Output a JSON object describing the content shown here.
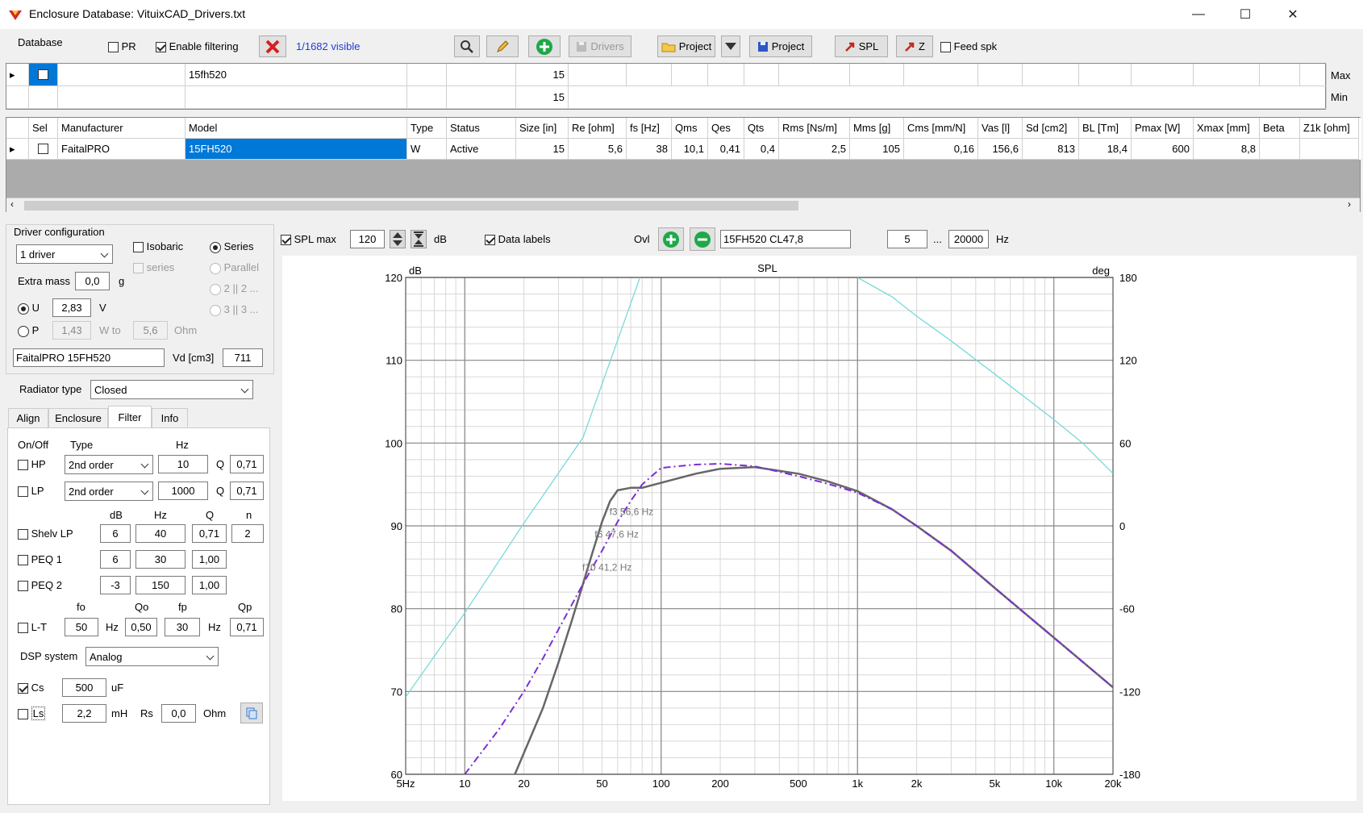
{
  "window": {
    "title": "Enclosure  Database: VituixCAD_Drivers.txt",
    "minimize": "—",
    "maximize": "☐",
    "close": "✕"
  },
  "toolbar": {
    "database_label": "Database",
    "pr_label": "PR",
    "pr_checked": false,
    "filter_label": "Enable filtering",
    "filter_checked": true,
    "visible_count": "1/1682 visible",
    "drivers_label": "Drivers",
    "project_open_label": "Project",
    "project_save_label": "Project",
    "spl_label": "SPL",
    "z_label": "Z",
    "feed_label": "Feed spk",
    "feed_checked": false
  },
  "filter_rows": {
    "max_model": "15fh520",
    "max_size": "15",
    "min_size": "15",
    "max_label": "Max",
    "min_label": "Min"
  },
  "table": {
    "columns": [
      "Sel",
      "Manufacturer",
      "Model",
      "Type",
      "Status",
      "Size [in]",
      "Re [ohm]",
      "fs [Hz]",
      "Qms",
      "Qes",
      "Qts",
      "Rms [Ns/m]",
      "Mms [g]",
      "Cms [mm/N]",
      "Vas [l]",
      "Sd [cm2]",
      "BL [Tm]",
      "Pmax [W]",
      "Xmax [mm]",
      "Beta",
      "Z1k [ohm]"
    ],
    "rows": [
      [
        "",
        "FaitalPRO",
        "15FH520",
        "W",
        "Active",
        "15",
        "5,6",
        "38",
        "10,1",
        "0,41",
        "0,4",
        "2,5",
        "105",
        "0,16",
        "156,6",
        "813",
        "18,4",
        "600",
        "8,8",
        "",
        ""
      ]
    ]
  },
  "driver_config": {
    "group_label": "Driver configuration",
    "driver_count": "1 driver",
    "isobaric_label": "Isobaric",
    "series_label": "Series",
    "series_small_label": "series",
    "parallel_label": "Parallel",
    "p22_label": "2 || 2 ...",
    "p33_label": "3 || 3 ...",
    "extra_mass_label": "Extra mass",
    "extra_mass": "0,0",
    "g_unit": "g",
    "u_label": "U",
    "u_value": "2,83",
    "v_unit": "V",
    "p_label": "P",
    "p_value": "1,43",
    "w_to_label": "W to",
    "ohm_value": "5,6",
    "ohm_unit": "Ohm",
    "driver_name": "FaitalPRO 15FH520",
    "vd_label": "Vd [cm3]",
    "vd_value": "711"
  },
  "radiator": {
    "label": "Radiator type",
    "value": "Closed"
  },
  "tabs": [
    "Align",
    "Enclosure",
    "Filter",
    "Info"
  ],
  "filter": {
    "onoff_label": "On/Off",
    "type_label": "Type",
    "hz_label": "Hz",
    "q_label": "Q",
    "hp": {
      "label": "HP",
      "type": "2nd order",
      "hz": "10",
      "q": "0,71"
    },
    "lp": {
      "label": "LP",
      "type": "2nd order",
      "hz": "1000",
      "q": "0,71"
    },
    "col_db": "dB",
    "col_hz": "Hz",
    "col_q": "Q",
    "col_n": "n",
    "shelv": {
      "label": "Shelv LP",
      "db": "6",
      "hz": "40",
      "q": "0,71",
      "n": "2"
    },
    "peq1": {
      "label": "PEQ 1",
      "db": "6",
      "hz": "30",
      "q": "1,00"
    },
    "peq2": {
      "label": "PEQ 2",
      "db": "-3",
      "hz": "150",
      "q": "1,00"
    },
    "lt_fo": "fo",
    "lt_qo": "Qo",
    "lt_fp": "fp",
    "lt_qp": "Qp",
    "lt": {
      "label": "L-T",
      "fo": "50",
      "hz1": "Hz",
      "qo": "0,50",
      "fp": "30",
      "hz2": "Hz",
      "qp": "0,71"
    },
    "dsp_label": "DSP system",
    "dsp_value": "Analog",
    "cs": {
      "label": "Cs",
      "value": "500",
      "unit": "uF",
      "checked": true
    },
    "ls": {
      "label": "Ls",
      "value": "2,2",
      "unit": "mH",
      "rs_label": "Rs",
      "rs_value": "0,0",
      "rs_unit": "Ohm"
    }
  },
  "chart_toolbar": {
    "spl_max_label": "SPL max",
    "spl_max": "120",
    "db_unit": "dB",
    "data_labels": "Data labels",
    "ovl_label": "Ovl",
    "overlay_name": "15FH520 CL47,8",
    "f_min": "5",
    "dots": "...",
    "f_max": "20000",
    "hz_unit": "Hz"
  },
  "colors": {
    "selection": "#0078d7",
    "spl_gray": "#666666",
    "overlay": "#7b2fd6",
    "phase": "#7ad9d9",
    "link": "#1e3ed6"
  },
  "chart_data": {
    "type": "line",
    "title": "SPL",
    "ylabel_left": "dB",
    "ylabel_right": "deg",
    "xscale": "log",
    "xlim": [
      5,
      20000
    ],
    "ylim": [
      60,
      120
    ],
    "y2lim": [
      -180,
      180
    ],
    "xticks": [
      "5Hz",
      "10",
      "20",
      "50",
      "100",
      "200",
      "500",
      "1k",
      "2k",
      "5k",
      "10k",
      "20k"
    ],
    "xtick_values": [
      5,
      10,
      20,
      50,
      100,
      200,
      500,
      1000,
      2000,
      5000,
      10000,
      20000
    ],
    "yticks": [
      60,
      70,
      80,
      90,
      100,
      110,
      120
    ],
    "y2ticks": [
      -180,
      -120,
      -60,
      0,
      60,
      120,
      180
    ],
    "annotations": [
      {
        "text": "f3 56,6 Hz",
        "x": 56.6,
        "y": 91.7
      },
      {
        "text": "f6 47,6 Hz",
        "x": 47.6,
        "y": 89
      },
      {
        "text": "f10 41,2 Hz",
        "x": 41.2,
        "y": 85
      }
    ],
    "series": [
      {
        "role": "spl",
        "axis": "left",
        "x": [
          18,
          25,
          30,
          35,
          40,
          45,
          50,
          55,
          60,
          70,
          80,
          100,
          150,
          200,
          300,
          500,
          700,
          1000,
          1500,
          2000,
          3000,
          5000,
          10000,
          20000
        ],
        "y": [
          60,
          68,
          73.5,
          78.5,
          83,
          87,
          90.5,
          93,
          94.3,
          94.6,
          94.6,
          95.2,
          96.3,
          96.9,
          97.1,
          96.3,
          95.4,
          94.2,
          92.0,
          90.0,
          87.0,
          82.5,
          76.5,
          70.5
        ]
      },
      {
        "role": "overlay",
        "axis": "left",
        "x": [
          10,
          15,
          20,
          25,
          30,
          40,
          50,
          60,
          70,
          80,
          100,
          150,
          200,
          300,
          500,
          700,
          1000,
          1500,
          2000,
          3000,
          5000,
          10000,
          20000
        ],
        "y": [
          60,
          65.5,
          70,
          74,
          77.5,
          83,
          87,
          90.5,
          93,
          95,
          97,
          97.4,
          97.5,
          97.2,
          96.0,
          95.1,
          94.0,
          92.0,
          90.0,
          87.0,
          82.5,
          76.5,
          70.5
        ]
      },
      {
        "role": "phase",
        "axis": "right",
        "x": [
          5,
          10,
          20,
          40,
          78
        ],
        "y": [
          -124,
          -63,
          2,
          64,
          180
        ]
      },
      {
        "role": "phase",
        "axis": "right",
        "x": [
          1000,
          1500,
          2000,
          3000,
          5000,
          7000,
          10000,
          14000,
          20000
        ],
        "y": [
          180,
          166,
          152,
          134,
          110,
          94,
          77,
          60,
          38
        ]
      }
    ]
  }
}
